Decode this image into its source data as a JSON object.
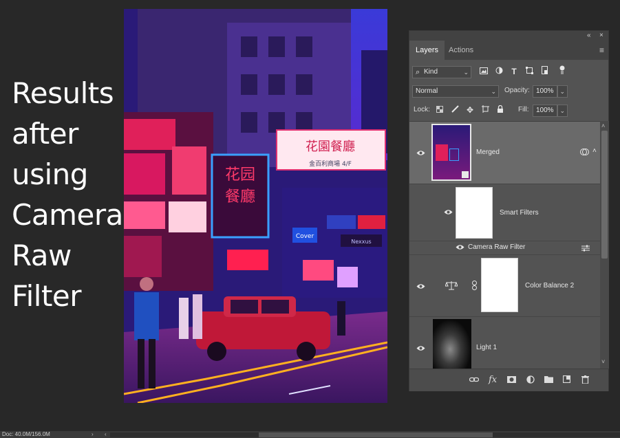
{
  "caption": {
    "lines": [
      "Results",
      "after",
      "using",
      "Camera",
      "Raw",
      "Filter"
    ]
  },
  "photo": {
    "signs": [
      "花園餐廳",
      "金百利商場 4/F",
      "花园",
      "餐廳",
      "Cover",
      "Nexxus"
    ]
  },
  "panel": {
    "topbar": {
      "collapse_glyph": "«",
      "close_glyph": "×"
    },
    "tabs": [
      {
        "label": "Layers",
        "active": true
      },
      {
        "label": "Actions",
        "active": false
      }
    ],
    "menu_glyph": "≡",
    "filter": {
      "search_glyph": "⌕",
      "kind_label": "Kind",
      "icons": [
        "image-filter-icon",
        "adjustment-filter-icon",
        "type-filter-icon",
        "shape-filter-icon",
        "smart-object-filter-icon",
        "filter-toggle-icon"
      ]
    },
    "blend": {
      "mode": "Normal",
      "opacity_label": "Opacity:",
      "opacity_value": "100%"
    },
    "lock": {
      "label": "Lock:",
      "fill_label": "Fill:",
      "fill_value": "100%"
    },
    "layers": [
      {
        "name": "Merged",
        "type": "smart-object",
        "selected": true
      },
      {
        "name": "Smart Filters",
        "type": "smart-filter-mask",
        "selected": false
      },
      {
        "name": "Camera Raw Filter",
        "type": "filter",
        "selected": false
      },
      {
        "name": "Color Balance 2",
        "type": "adjustment",
        "selected": false
      },
      {
        "name": "Light 1",
        "type": "pixel",
        "selected": false
      }
    ],
    "bottom_icons": [
      "link-layers-icon",
      "fx-icon",
      "add-mask-icon",
      "new-adjustment-icon",
      "new-group-icon",
      "new-layer-icon",
      "delete-layer-icon"
    ],
    "fx_label": "fx"
  },
  "status": {
    "doc": "Doc: 40.0M/156.0M",
    "arrow": "›",
    "left_arrow": "‹"
  }
}
